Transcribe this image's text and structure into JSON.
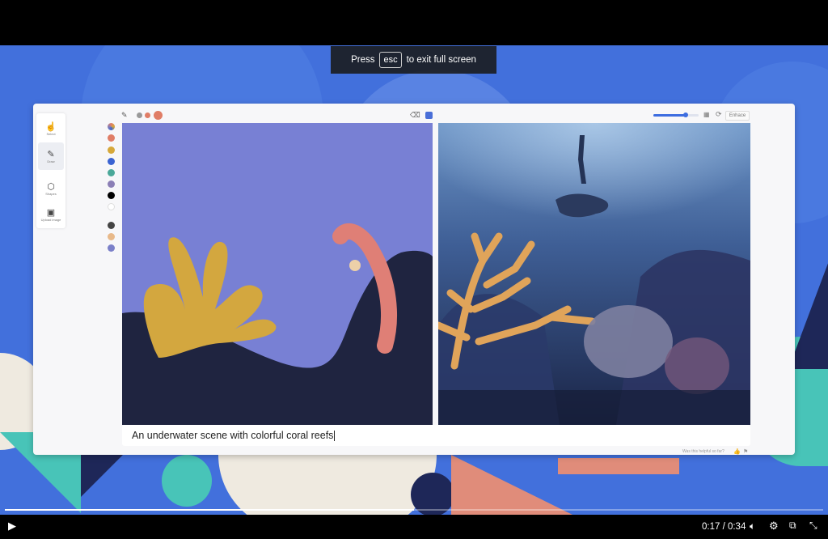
{
  "fullscreen_banner": {
    "press": "Press",
    "key": "esc",
    "suffix": "to exit full screen"
  },
  "app": {
    "tools": [
      {
        "label": "Select",
        "icon": "select-icon"
      },
      {
        "label": "Draw",
        "icon": "brush-icon"
      },
      {
        "label": "Shapes",
        "icon": "shapes-icon"
      },
      {
        "label": "Upload image",
        "icon": "image-icon"
      }
    ],
    "palette_colors": [
      "#e07d66",
      "#d6a83a",
      "#3a63d2",
      "#4aa899",
      "#8b7fb6",
      "#000000",
      "#ffffff",
      "#444444",
      "#e8b98a",
      "#7b80c9"
    ],
    "enhance_label": "Enhace",
    "prompt_text": "An underwater scene with colorful coral reefs",
    "feedback_text": "Was this helpful so far?",
    "creativity_level": 0.72
  },
  "player": {
    "time": "0:17 / 0:34",
    "progress": 0.5,
    "icons": [
      "play-icon",
      "volume-icon",
      "settings-icon",
      "popout-icon",
      "exit-fullscreen-icon"
    ]
  }
}
